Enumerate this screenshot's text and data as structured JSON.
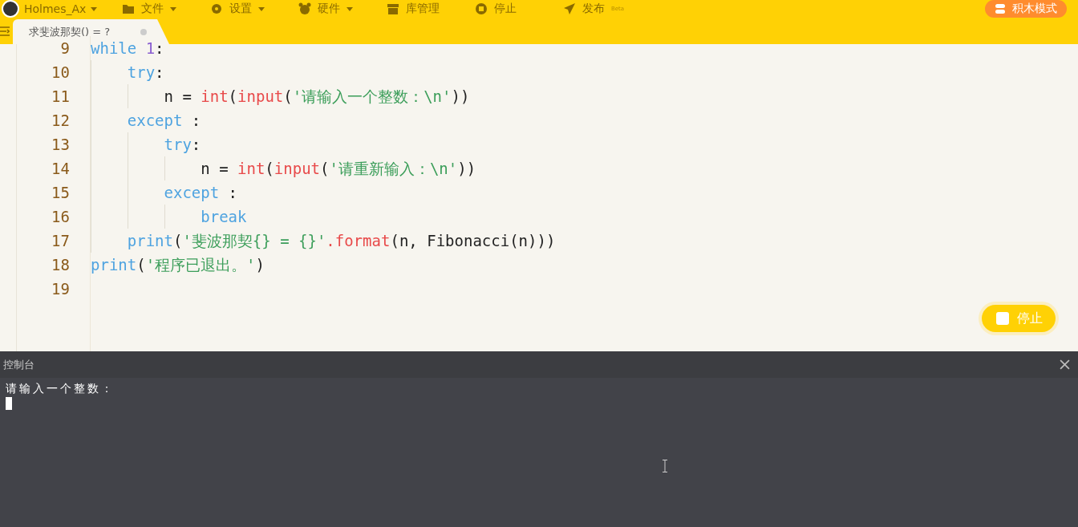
{
  "menu_bar": {
    "user": "Holmes_Ax",
    "items": [
      {
        "label": "文件",
        "dropdown": true
      },
      {
        "label": "设置",
        "dropdown": true
      },
      {
        "label": "硬件",
        "dropdown": true
      },
      {
        "label": "库管理",
        "dropdown": false
      },
      {
        "label": "停止",
        "dropdown": false
      },
      {
        "label": "发布",
        "dropdown": false,
        "badge": "Beta"
      }
    ],
    "mode_button": "积木模式"
  },
  "tabs": [
    {
      "label": "求斐波那契() = ?",
      "selected": true
    }
  ],
  "editor": {
    "lines": [
      {
        "number": "9",
        "tokens": [
          {
            "kind": "kw",
            "text": "while"
          },
          {
            "kind": "num",
            "text": " 1"
          },
          {
            "kind": "plain",
            "text": ":"
          }
        ]
      },
      {
        "number": "10",
        "tokens": [
          {
            "kind": "kw",
            "text": "    try"
          },
          {
            "kind": "plain",
            "text": ":"
          }
        ]
      },
      {
        "number": "11",
        "tokens": [
          {
            "kind": "plain",
            "text": "        n = "
          },
          {
            "kind": "fn",
            "text": "int"
          },
          {
            "kind": "plain",
            "text": "("
          },
          {
            "kind": "fn",
            "text": "input"
          },
          {
            "kind": "plain",
            "text": "("
          },
          {
            "kind": "str",
            "text": "'请输入一个整数：\\n'"
          },
          {
            "kind": "plain",
            "text": "))"
          }
        ]
      },
      {
        "number": "12",
        "tokens": [
          {
            "kind": "kw",
            "text": "    except"
          },
          {
            "kind": "plain",
            "text": " :"
          }
        ]
      },
      {
        "number": "13",
        "tokens": [
          {
            "kind": "kw",
            "text": "        try"
          },
          {
            "kind": "plain",
            "text": ":"
          }
        ]
      },
      {
        "number": "14",
        "tokens": [
          {
            "kind": "plain",
            "text": "            n = "
          },
          {
            "kind": "fn",
            "text": "int"
          },
          {
            "kind": "plain",
            "text": "("
          },
          {
            "kind": "fn",
            "text": "input"
          },
          {
            "kind": "plain",
            "text": "("
          },
          {
            "kind": "str",
            "text": "'请重新输入：\\n'"
          },
          {
            "kind": "plain",
            "text": "))"
          }
        ]
      },
      {
        "number": "15",
        "tokens": [
          {
            "kind": "kw",
            "text": "        except"
          },
          {
            "kind": "plain",
            "text": " :"
          }
        ]
      },
      {
        "number": "16",
        "tokens": [
          {
            "kind": "kw",
            "text": "            break"
          }
        ]
      },
      {
        "number": "17",
        "tokens": [
          {
            "kind": "kw",
            "text": "    print"
          },
          {
            "kind": "plain",
            "text": "("
          },
          {
            "kind": "str",
            "text": "'斐波那契{} = {}'"
          },
          {
            "kind": "fn",
            "text": ".format"
          },
          {
            "kind": "plain",
            "text": "(n, Fibonacci(n)))"
          }
        ]
      },
      {
        "number": "18",
        "tokens": [
          {
            "kind": "kw",
            "text": "print"
          },
          {
            "kind": "plain",
            "text": "("
          },
          {
            "kind": "str",
            "text": "'程序已退出。'"
          },
          {
            "kind": "plain",
            "text": ")"
          }
        ]
      },
      {
        "number": "19"
      }
    ]
  },
  "stop_button": "停止",
  "console": {
    "title": "控制台",
    "output": "请输入一个整数："
  }
}
